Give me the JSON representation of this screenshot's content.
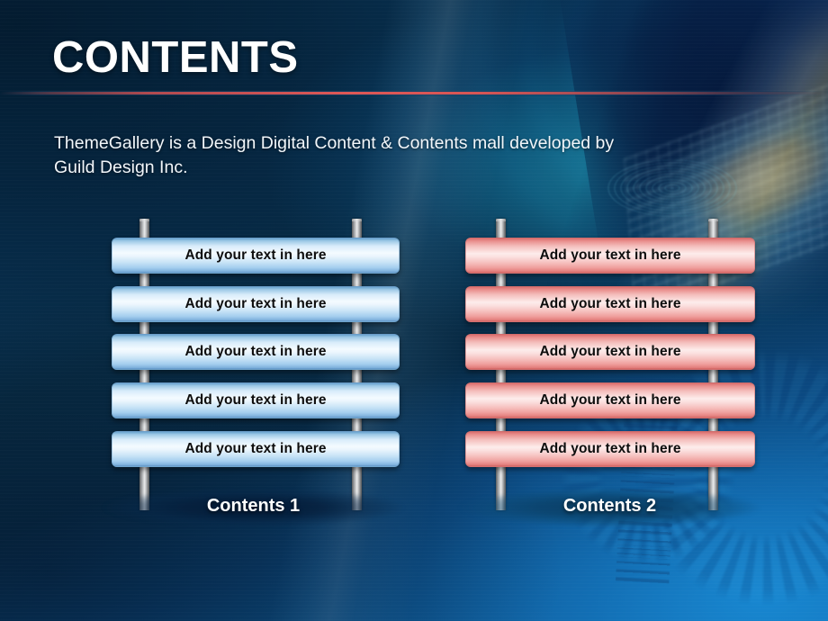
{
  "slide": {
    "title": "CONTENTS",
    "subtitle": "ThemeGallery is a Design Digital Content & Contents mall developed by Guild Design Inc."
  },
  "groups": [
    {
      "id": "contents-1",
      "label": "Contents 1",
      "color": "#9cc8e6",
      "planks": [
        {
          "text": "Add your text in here"
        },
        {
          "text": "Add your text in here"
        },
        {
          "text": "Add your text in here"
        },
        {
          "text": "Add your text in here"
        },
        {
          "text": "Add your text in here"
        }
      ]
    },
    {
      "id": "contents-2",
      "label": "Contents 2",
      "color": "#e88d8b",
      "planks": [
        {
          "text": "Add your text in here"
        },
        {
          "text": "Add your text in here"
        },
        {
          "text": "Add your text in here"
        },
        {
          "text": "Add your text in here"
        },
        {
          "text": "Add your text in here"
        }
      ]
    }
  ]
}
